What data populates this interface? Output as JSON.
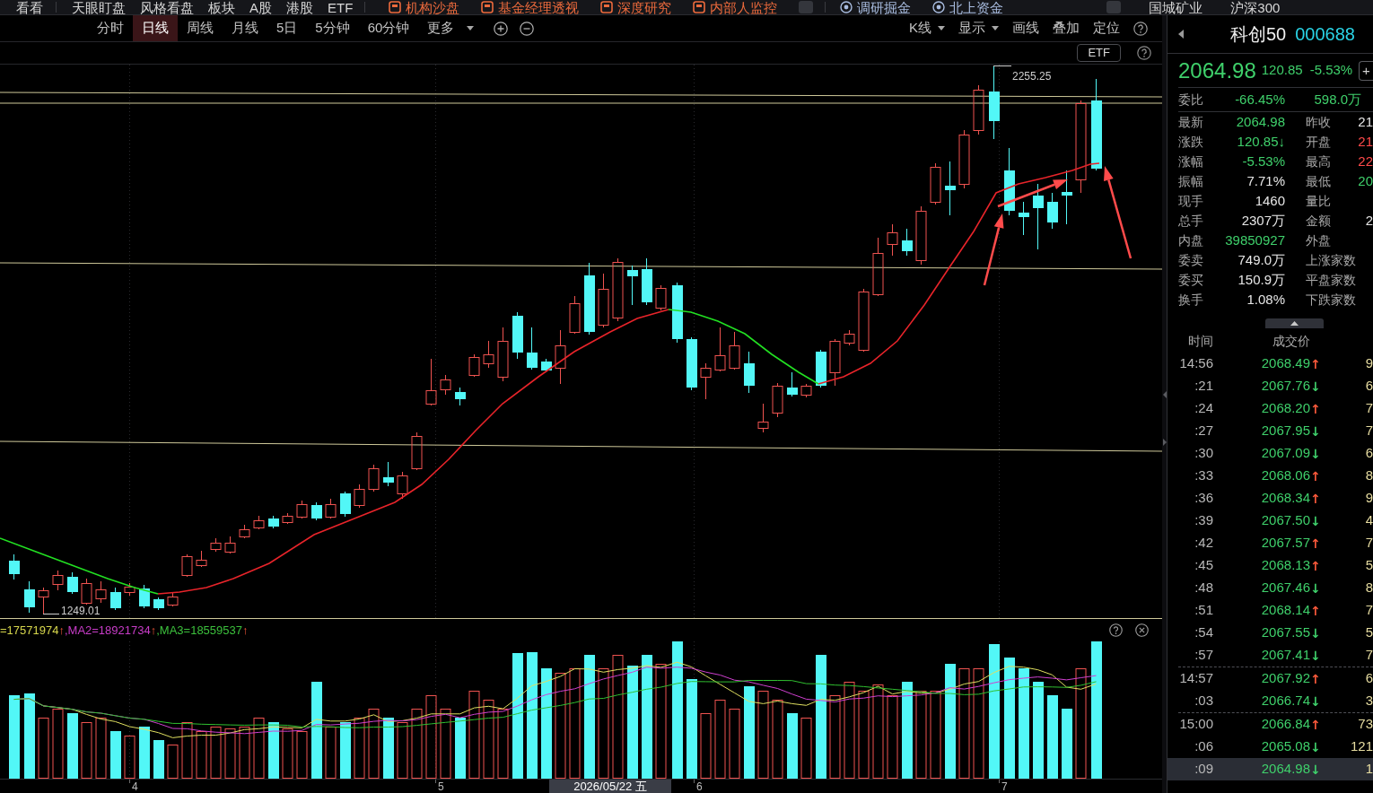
{
  "top_nav": [
    {
      "items": [
        {
          "kind": "plain",
          "label": "看看"
        }
      ]
    },
    {
      "items": [
        {
          "kind": "plain",
          "label": "天眼盯盘"
        },
        {
          "kind": "plain",
          "label": "风格看盘"
        },
        {
          "kind": "plain",
          "label": "板块"
        },
        {
          "kind": "plain",
          "label": "A股"
        },
        {
          "kind": "plain",
          "label": "港股"
        },
        {
          "kind": "plain",
          "label": "ETF"
        }
      ]
    },
    {
      "items": [
        {
          "kind": "feature",
          "label": "机构沙盘"
        },
        {
          "kind": "feature",
          "label": "基金经理透视"
        },
        {
          "kind": "feature",
          "label": "深度研究"
        },
        {
          "kind": "feature",
          "label": "内部人监控"
        },
        {
          "kind": "tile"
        }
      ]
    },
    {
      "items": [
        {
          "kind": "research",
          "label": "调研掘金"
        },
        {
          "kind": "research",
          "label": "北上资金"
        }
      ]
    },
    {
      "items": [
        {
          "kind": "tile"
        },
        {
          "kind": "plain",
          "label": "国城矿业"
        },
        {
          "kind": "plain",
          "label": "沪深300"
        }
      ]
    }
  ],
  "period_tabs": [
    {
      "label": "分时",
      "selected": false,
      "dropdown": false
    },
    {
      "label": "日线",
      "selected": true,
      "dropdown": false
    },
    {
      "label": "周线",
      "selected": false,
      "dropdown": false
    },
    {
      "label": "月线",
      "selected": false,
      "dropdown": false
    },
    {
      "label": "5日",
      "selected": false,
      "dropdown": false
    },
    {
      "label": "5分钟",
      "selected": false,
      "dropdown": false
    },
    {
      "label": "60分钟",
      "selected": false,
      "dropdown": false
    },
    {
      "label": "更多",
      "selected": false,
      "dropdown": true
    }
  ],
  "chart_tools": [
    {
      "label": "K线",
      "dropdown": true
    },
    {
      "label": "显示",
      "dropdown": true
    },
    {
      "label": "画线",
      "dropdown": false
    },
    {
      "label": "叠加",
      "dropdown": false
    },
    {
      "label": "定位",
      "dropdown": false
    }
  ],
  "etf_button": "ETF",
  "price_chart": {
    "high_label": "2255.25",
    "low_label": "1249.01"
  },
  "volume_legend": [
    {
      "text": "=17571974",
      "arrow": "↑",
      "color": "#d6d64c"
    },
    {
      "text": ",MA2=18921734",
      "arrow": "↑",
      "color": "#c83cc8"
    },
    {
      "text": ",MA3=18559537",
      "arrow": "↑",
      "color": "#3cc03c"
    }
  ],
  "x_axis": {
    "labels": [
      "4",
      "5",
      "6",
      "7"
    ],
    "cursor_date": "2026/05/22 五"
  },
  "quote_panel": {
    "name": "科创50",
    "code": "000688",
    "price": "2064.98",
    "change": "120.85",
    "change_pct": "-5.53%",
    "add_button": "+",
    "commission": {
      "label": "委比",
      "ratio": "-66.45%",
      "diff": "598.0万"
    },
    "stats": [
      {
        "label": "最新",
        "value": "2064.98",
        "color": "#3fd06b"
      },
      {
        "label": "昨收",
        "value": "21",
        "color": "#e6e6e6"
      },
      {
        "label": "涨跌",
        "value": "120.85↓",
        "color": "#3fd06b"
      },
      {
        "label": "开盘",
        "value": "21",
        "color": "#ff4a4a"
      },
      {
        "label": "涨幅",
        "value": "-5.53%",
        "color": "#3fd06b"
      },
      {
        "label": "最高",
        "value": "22",
        "color": "#ff4a4a"
      },
      {
        "label": "振幅",
        "value": "7.71%",
        "color": "#e6e6e6"
      },
      {
        "label": "最低",
        "value": "20",
        "color": "#3fd06b"
      },
      {
        "label": "现手",
        "value": "1460",
        "color": "#e6e6e6"
      },
      {
        "label": "量比"
      },
      {
        "label": "总手",
        "value": "2307万",
        "color": "#e6e6e6"
      },
      {
        "label": "金额",
        "value": "2",
        "color": "#e6e6e6"
      },
      {
        "label": "内盘",
        "value": "39850927",
        "color": "#3fd06b"
      },
      {
        "label": "外盘"
      },
      {
        "label": "委卖",
        "value": "749.0万",
        "color": "#e6e6e6"
      },
      {
        "label": "上涨家数"
      },
      {
        "label": "委买",
        "value": "150.9万",
        "color": "#e6e6e6"
      },
      {
        "label": "平盘家数"
      },
      {
        "label": "换手",
        "value": "1.08%",
        "color": "#e6e6e6"
      },
      {
        "label": "下跌家数"
      }
    ]
  },
  "trades": {
    "columns": [
      "时间",
      "成交价"
    ],
    "groups": [
      {
        "rows": [
          {
            "time": "14:56",
            "price": "2068.49",
            "arrow": "↑",
            "color": "#ff5a3c",
            "volume": "9",
            "selected": false
          },
          {
            "time": ":21",
            "price": "2067.76",
            "arrow": "↓",
            "color": "#3fd06b",
            "volume": "6",
            "selected": false
          },
          {
            "time": ":24",
            "price": "2068.20",
            "arrow": "↑",
            "color": "#ff5a3c",
            "volume": "7",
            "selected": false
          },
          {
            "time": ":27",
            "price": "2067.95",
            "arrow": "↓",
            "color": "#3fd06b",
            "volume": "7",
            "selected": false
          },
          {
            "time": ":30",
            "price": "2067.09",
            "arrow": "↓",
            "color": "#3fd06b",
            "volume": "6",
            "selected": false
          },
          {
            "time": ":33",
            "price": "2068.06",
            "arrow": "↑",
            "color": "#ff5a3c",
            "volume": "8",
            "selected": false
          },
          {
            "time": ":36",
            "price": "2068.34",
            "arrow": "↑",
            "color": "#ff5a3c",
            "volume": "9",
            "selected": false
          },
          {
            "time": ":39",
            "price": "2067.50",
            "arrow": "↓",
            "color": "#3fd06b",
            "volume": "4",
            "selected": false
          },
          {
            "time": ":42",
            "price": "2067.57",
            "arrow": "↑",
            "color": "#ff5a3c",
            "volume": "7",
            "selected": false
          },
          {
            "time": ":45",
            "price": "2068.13",
            "arrow": "↑",
            "color": "#ff5a3c",
            "volume": "5",
            "selected": false
          },
          {
            "time": ":48",
            "price": "2067.46",
            "arrow": "↓",
            "color": "#3fd06b",
            "volume": "8",
            "selected": false
          },
          {
            "time": ":51",
            "price": "2068.14",
            "arrow": "↑",
            "color": "#ff5a3c",
            "volume": "7",
            "selected": false
          },
          {
            "time": ":54",
            "price": "2067.55",
            "arrow": "↓",
            "color": "#3fd06b",
            "volume": "5",
            "selected": false
          },
          {
            "time": ":57",
            "price": "2067.41",
            "arrow": "↓",
            "color": "#3fd06b",
            "volume": "7",
            "selected": false
          }
        ]
      },
      {
        "rows": [
          {
            "time": "14:57",
            "price": "2067.92",
            "arrow": "↑",
            "color": "#ff5a3c",
            "volume": "6",
            "selected": false
          },
          {
            "time": ":03",
            "price": "2066.74",
            "arrow": "↓",
            "color": "#3fd06b",
            "volume": "3",
            "selected": false
          }
        ]
      },
      {
        "rows": [
          {
            "time": "15:00",
            "price": "2066.84",
            "arrow": "↑",
            "color": "#ff5a3c",
            "volume": "73",
            "selected": false
          },
          {
            "time": ":06",
            "price": "2065.08",
            "arrow": "↓",
            "color": "#3fd06b",
            "volume": "121",
            "selected": false
          },
          {
            "time": ":09",
            "price": "2064.98",
            "arrow": "↓",
            "color": "#3fd06b",
            "volume": "1",
            "selected": true
          }
        ]
      }
    ]
  }
}
